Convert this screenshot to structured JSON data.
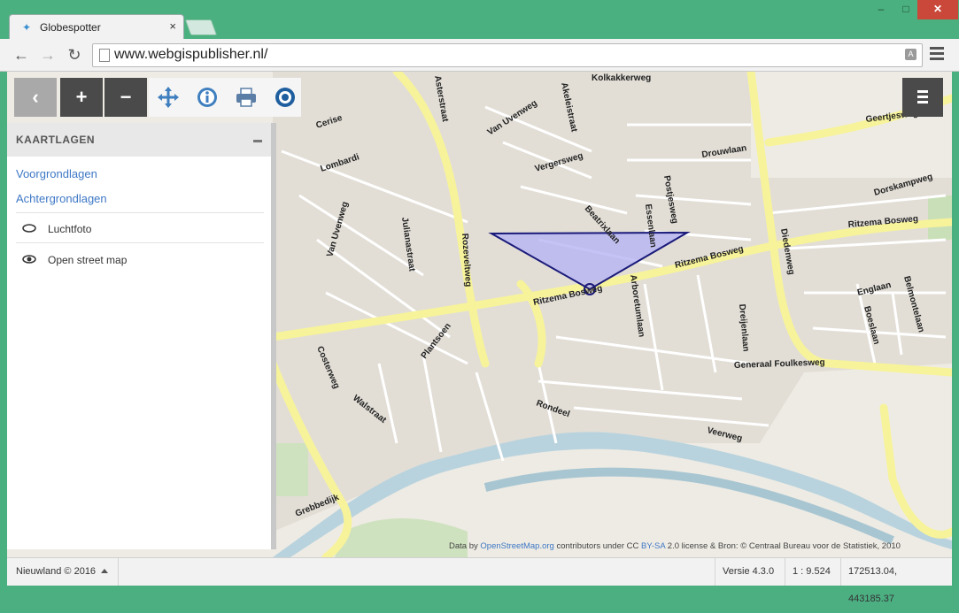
{
  "browser": {
    "tab_title": "Globespotter",
    "url": "www.webgispublisher.nl/",
    "win_min": "–",
    "win_max": "□",
    "win_close": "✕",
    "tab_close": "×"
  },
  "toolbar": {
    "back_glyph": "←",
    "forward_glyph": "→",
    "reload_glyph": "↻"
  },
  "map_tools": {
    "back": "‹",
    "zoom_in": "+",
    "zoom_out": "−",
    "icons": [
      "pan-icon",
      "info-icon",
      "print-icon",
      "globespotter-icon"
    ]
  },
  "sidebar": {
    "title": "KAARTLAGEN",
    "links": [
      "Voorgrondlagen",
      "Achtergrondlagen"
    ],
    "layers": [
      {
        "label": "Luchtfoto",
        "visible": false
      },
      {
        "label": "Open street map",
        "visible": true
      }
    ]
  },
  "map": {
    "streets": [
      "Kolkakkerweg",
      "Asterstraat",
      "Akeleistraat",
      "Van Uvenweg",
      "Cerise",
      "Lombardi",
      "Geertjesweg",
      "Drouwlaan",
      "Vergersweg",
      "Postjesweg",
      "Beatrixlaan",
      "Essenlaan",
      "Dorskampweg",
      "Rozeveltweg",
      "Julianastraat",
      "Van Uvenweg",
      "Ritzema Bosweg",
      "Ritzema Bosweg",
      "Ritzema Bosweg",
      "Diedenweg",
      "Arboretumlaan",
      "Dreijenlaan",
      "Englaan",
      "Boeslaan",
      "Belmontelaan",
      "Costerweg",
      "Plantsoen",
      "Generaal Foulkesweg",
      "Walstraat",
      "Rondeel",
      "Veerweg",
      "Grebbedijk"
    ],
    "attribution_prefix": "Data by ",
    "attribution_osm": "OpenStreetMap.org",
    "attribution_mid": " contributors under CC ",
    "attribution_bysa": "BY-SA",
    "attribution_suffix": " 2.0 license & Bron: © Centraal Bureau voor de Statistiek, 2010"
  },
  "status": {
    "copyright": "Nieuwland © 2016",
    "version": "Versie 4.3.0",
    "scale": "1 : 9.524",
    "coordinates": "172513.04, 443185.37"
  },
  "colors": {
    "accent": "#3e78c5",
    "dark_button": "#4a4a4a",
    "viewcone_fill": "#b7b4f2",
    "viewcone_stroke": "#1a1a7a",
    "major_road": "#f7f39a"
  }
}
